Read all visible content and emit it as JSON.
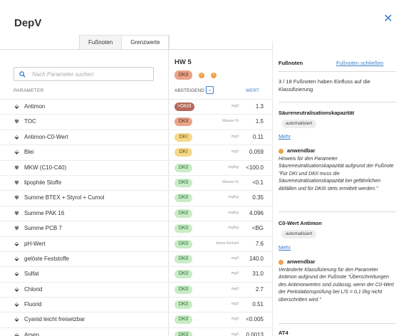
{
  "app": {
    "title": "DepV"
  },
  "tabs": [
    {
      "label": "Fußnoten"
    },
    {
      "label": "Grenzwerte"
    }
  ],
  "search": {
    "placeholder": "Nach Parameter suchen"
  },
  "param_header": "PARAMETER",
  "hw": {
    "title": "HW 5",
    "badge": "DKII",
    "dot_count": 2
  },
  "sort": {
    "label": "ABSTEIGEND",
    "value_header": "WERT"
  },
  "rows": [
    {
      "icon": "drop-icon",
      "name": "Antimon",
      "badge": ">DKIII",
      "class": "dkiii",
      "unit": "mg/l",
      "value": "1.3"
    },
    {
      "icon": "molecule-icon",
      "name": "TOC",
      "badge": "DKII",
      "class": "dkii",
      "unit": "Masse-%",
      "value": "1.5"
    },
    {
      "icon": "drop-icon",
      "name": "Antimon-C0-Wert",
      "badge": "DKI",
      "class": "dki",
      "unit": "mg/l",
      "value": "0.11"
    },
    {
      "icon": "drop-icon",
      "name": "Blei",
      "badge": "DKI",
      "class": "dki",
      "unit": "mg/l",
      "value": "0.059"
    },
    {
      "icon": "molecule-icon",
      "name": "MKW (C10-C40)",
      "badge": "DK0",
      "class": "dk0",
      "unit": "mg/kg",
      "value": "<100.0"
    },
    {
      "icon": "molecule-icon",
      "name": "lipophile Stoffe",
      "badge": "DK0",
      "class": "dk0",
      "unit": "Masse-%",
      "value": "<0.1"
    },
    {
      "icon": "molecule-icon",
      "name": "Summe BTEX + Styrol + Cumol",
      "badge": "DK0",
      "class": "dk0",
      "unit": "mg/kg",
      "value": "0.35"
    },
    {
      "icon": "molecule-icon",
      "name": "Summe PAK 16",
      "badge": "DK0",
      "class": "dk0",
      "unit": "mg/kg",
      "value": "4.096"
    },
    {
      "icon": "molecule-icon",
      "name": "Summe PCB 7",
      "badge": "DK0",
      "class": "dk0",
      "unit": "mg/kg",
      "value": "<BG"
    },
    {
      "icon": "drop-icon",
      "name": "pH-Wert",
      "badge": "DK0",
      "class": "dk0",
      "unit": "keine Einheit",
      "value": "7.6"
    },
    {
      "icon": "drop-icon",
      "name": "gelöste Feststoffe",
      "badge": "DK0",
      "class": "dk0",
      "unit": "mg/l",
      "value": "140.0"
    },
    {
      "icon": "drop-icon",
      "name": "Sulfat",
      "badge": "DK0",
      "class": "dk0",
      "unit": "mg/l",
      "value": "31.0"
    },
    {
      "icon": "drop-icon",
      "name": "Chlorid",
      "badge": "DK0",
      "class": "dk0",
      "unit": "mg/l",
      "value": "2.7"
    },
    {
      "icon": "drop-icon",
      "name": "Fluorid",
      "badge": "DK0",
      "class": "dk0",
      "unit": "mg/l",
      "value": "0.51"
    },
    {
      "icon": "drop-icon",
      "name": "Cyanid leicht freisetzbar",
      "badge": "DK0",
      "class": "dk0",
      "unit": "mg/l",
      "value": "<0.005"
    },
    {
      "icon": "drop-icon",
      "name": "Arsen",
      "badge": "DK0",
      "class": "dk0",
      "unit": "mg/l",
      "value": "0.0013"
    }
  ],
  "footnotes": {
    "header": "Fußnoten",
    "close_label": "Fußnoten schließen",
    "summary": "3 / 18 Fußnoten haben Einfluss auf die Klassifizierung",
    "items": [
      {
        "title": "Säureneutralisationskapazität",
        "chip": "automatisiert",
        "mehr": "Mehr",
        "status": "anwendbar",
        "text": "Hinweis für den Parameter Säureneutralisationskapazität aufgrund der Fußnote \"Für DKI und DKII muss die Säureneutralisationskapazität bei gefährlichen Abfällen und für DKIII stets ermittelt werden.\""
      },
      {
        "title": "C0-Wert Antimon",
        "chip": "automatisiert",
        "mehr": "Mehr",
        "status": "anwendbar",
        "text": "Veränderte Klassifizierung für den Parameter Antimon aufgrund der Fußnote \"Überschreitungen des Antimonwertes sind zulässig, wenn der C0-Wert der Perkolationsprüfung bei L/S = 0,1 l/kg nicht überschritten wird.\""
      },
      {
        "title": "AT4"
      }
    ]
  },
  "colors": {
    "accent": "#3b7ec7",
    "dkiii": "#b4685b",
    "dkii": "#e8a488",
    "dki": "#f5d98a",
    "dk0": "#c8ecc5",
    "dot": "#f0a04b"
  }
}
